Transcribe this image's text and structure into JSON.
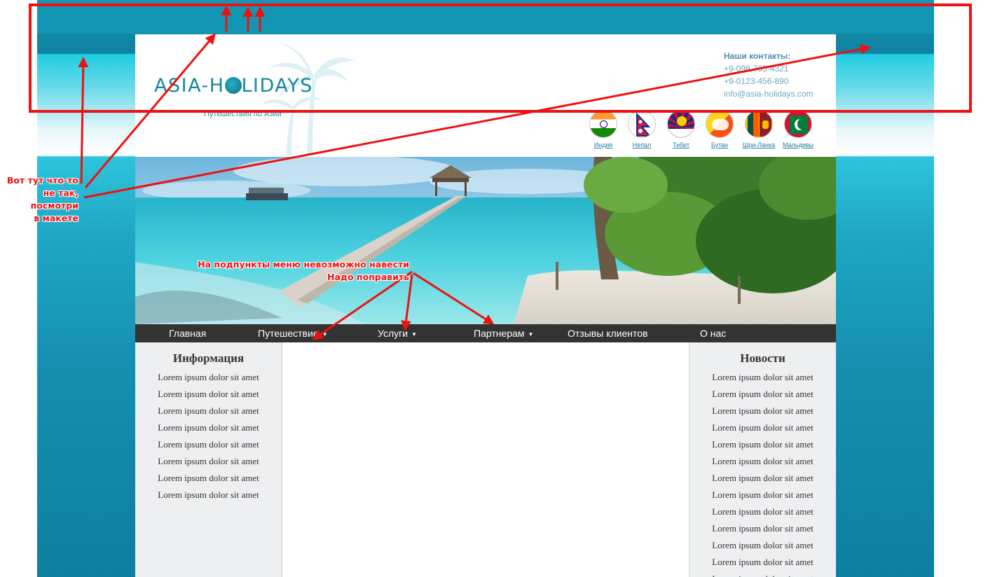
{
  "site": {
    "logo": {
      "text_before": "ASIA-H",
      "text_after": "LIDAYS"
    },
    "tagline": "Путешествия по Азии",
    "contacts": {
      "title": "Наши контакты:",
      "phone1": "+9-098-765-4321",
      "phone2": "+9-0123-456-890",
      "email": "info@asia-holidays.com"
    },
    "flags": [
      {
        "label": "Индия",
        "icon": "india-flag-icon"
      },
      {
        "label": "Непал",
        "icon": "nepal-flag-icon"
      },
      {
        "label": "Тибет",
        "icon": "tibet-flag-icon"
      },
      {
        "label": "Бутан",
        "icon": "bhutan-flag-icon"
      },
      {
        "label": "Шри-Ланка",
        "icon": "sri-lanka-flag-icon"
      },
      {
        "label": "Мальдивы",
        "icon": "maldives-flag-icon"
      }
    ]
  },
  "nav": {
    "items": [
      {
        "label": "Главная",
        "has_submenu": false
      },
      {
        "label": "Путешествие",
        "has_submenu": true
      },
      {
        "label": "Услуги",
        "has_submenu": true
      },
      {
        "label": "Партнерам",
        "has_submenu": true
      },
      {
        "label": "Отзывы клиентов",
        "has_submenu": false
      },
      {
        "label": "О нас",
        "has_submenu": false
      }
    ],
    "caret": "▼"
  },
  "left_sidebar": {
    "title": "Информация",
    "items": [
      "Lorem ipsum dolor sit amet",
      "Lorem ipsum dolor sit amet",
      "Lorem ipsum dolor sit amet",
      "Lorem ipsum dolor sit amet",
      "Lorem ipsum dolor sit amet",
      "Lorem ipsum dolor sit amet",
      "Lorem ipsum dolor sit amet",
      "Lorem ipsum dolor sit amet"
    ]
  },
  "right_sidebar": {
    "title": "Новости",
    "items": [
      "Lorem ipsum dolor sit amet",
      "Lorem ipsum dolor sit amet",
      "Lorem ipsum dolor sit amet",
      "Lorem ipsum dolor sit amet",
      "Lorem ipsum dolor sit amet",
      "Lorem ipsum dolor sit amet",
      "Lorem ipsum dolor sit amet",
      "Lorem ipsum dolor sit amet",
      "Lorem ipsum dolor sit amet",
      "Lorem ipsum dolor sit amet",
      "Lorem ipsum dolor sit amet",
      "Lorem ipsum dolor sit amet",
      "Lorem ipsum dolor sit amet"
    ]
  },
  "annotations": {
    "header_note_lines": [
      "Вот тут что-то",
      "не так,",
      "посмотри",
      "в макете"
    ],
    "menu_note_lines": [
      "На подпункты меню невозможно навести",
      "Надо поправить"
    ]
  },
  "colors": {
    "accent": "#1587a0",
    "annotation": "#ee1111",
    "nav_bg": "#333333",
    "sidebar_bg": "#eeeff1"
  }
}
